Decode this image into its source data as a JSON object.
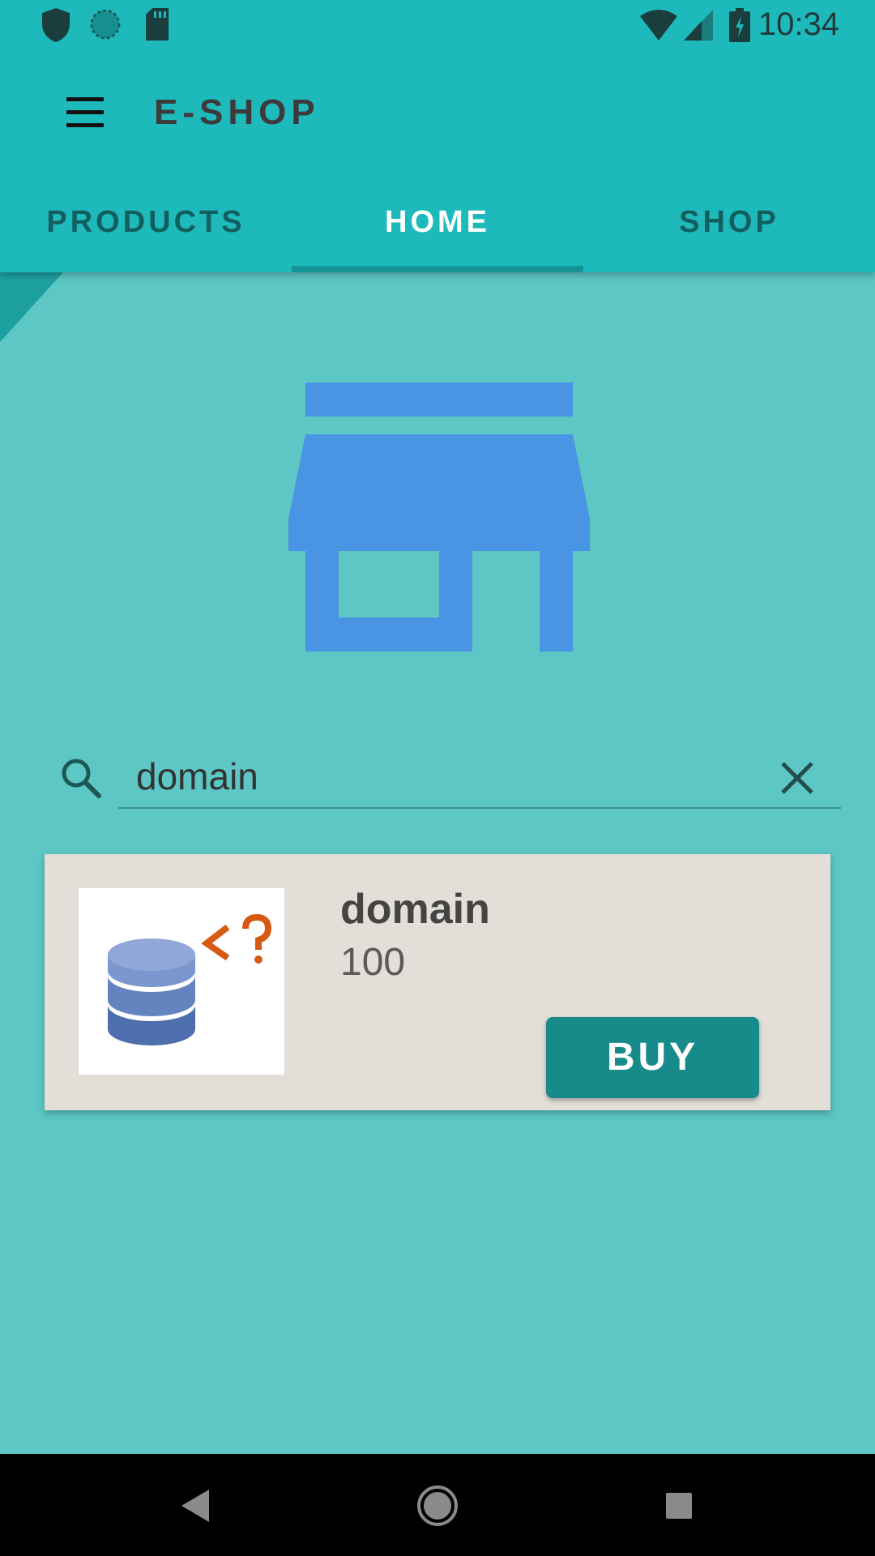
{
  "status_bar": {
    "time": "10:34",
    "left_icons": [
      "shield-icon",
      "sync-icon",
      "sd-card-icon"
    ],
    "right_icons": [
      "wifi-icon",
      "signal-icon",
      "battery-charging-icon"
    ]
  },
  "toolbar": {
    "title": "E-SHOP",
    "menu_icon": "menu-icon"
  },
  "tabs": [
    {
      "label": "PRODUCTS",
      "active": false
    },
    {
      "label": "HOME",
      "active": true
    },
    {
      "label": "SHOP",
      "active": false
    }
  ],
  "hero": {
    "icon": "store-icon"
  },
  "search": {
    "value": "domain",
    "icon": "search-icon",
    "clear_icon": "close-icon"
  },
  "products": [
    {
      "name": "domain",
      "price": "100",
      "buy_label": "BUY",
      "image_icon": "database-question-icon"
    }
  ],
  "navigation": [
    "back-icon",
    "home-icon",
    "recents-icon"
  ],
  "colors": {
    "app_bar": "#1EBABB",
    "background": "#5CC7C4",
    "store_icon": "#4A95E3",
    "buy_button": "#178A8A",
    "card": "#E3DED7"
  }
}
